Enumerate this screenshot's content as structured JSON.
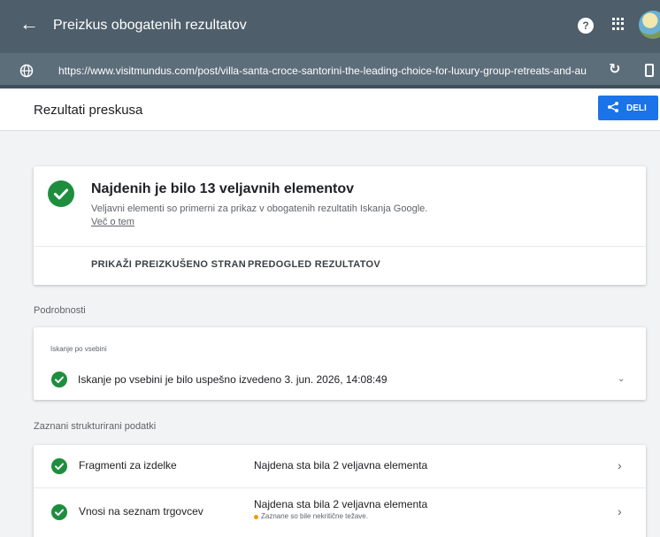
{
  "appbar": {
    "back_icon": "arrow-back-icon",
    "title": "Preizkus obogatenih rezultatov",
    "help_icon": "help-icon",
    "apps_icon": "apps-grid-icon"
  },
  "urlbar": {
    "url": "https://www.visitmundus.com/post/villa-santa-croce-santorini-the-leading-choice-for-luxury-group-retreats-and-au"
  },
  "subheader": {
    "title": "Rezultati preskusa",
    "share_label": "DELI"
  },
  "summary": {
    "heading": "Najdenih je bilo 13 veljavnih elementov",
    "description": "Veljavni elementi so primerni za prikaz v obogatenih rezultatih Iskanja Google.",
    "learn_more": "Več o tem",
    "actions": [
      "PRIKAŽI PREIZKUŠENO STRAN",
      "PREDOGLED REZULTATOV"
    ]
  },
  "details": {
    "section_label": "Podrobnosti",
    "crawl_label": "Iskanje po vsebini",
    "crawl_status": "Iskanje po vsebini je bilo uspešno izvedeno 3. jun. 2026, 14:08:49"
  },
  "structured_data": {
    "section_label": "Zaznani strukturirani podatki",
    "rows": [
      {
        "name": "Fragmenti za izdelke",
        "result": "Najdena sta bila 2 veljavna elementa",
        "note": ""
      },
      {
        "name": "Vnosi na seznam trgovcev",
        "result": "Najdena sta bila 2 veljavna elementa",
        "note": "Zaznane so bile nekritične težave."
      }
    ]
  },
  "colors": {
    "appbar": "#4e5e6a",
    "urlbar": "#5d6e7b",
    "accent": "#1a73e8",
    "success": "#1e8e3e",
    "warning": "#f29900"
  }
}
